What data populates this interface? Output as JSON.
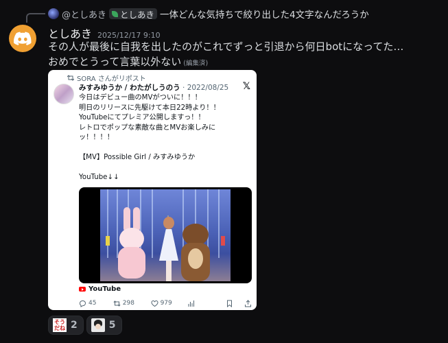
{
  "reply": {
    "username": "@としあき",
    "role_label": "としあき",
    "text": "一体どんな気持ちで絞り出した4文字なんだろうか"
  },
  "message": {
    "author": "としあき",
    "timestamp": "2025/12/17 9:10",
    "line1": "その人が最後に自我を出したのがこれでずっと引退から何日botになってた…",
    "line2": "おめでとうって言葉以外ない",
    "edited": "(編集済)"
  },
  "embed": {
    "repost": "SORA さんがリポスト",
    "author_name": "みすみゆうか / わたがしうのう",
    "date": "2022/08/25",
    "x_logo": "𝕏",
    "body": "今日はデビュー曲のMVがついに！！！\n明日のリリースに先駆けて本日22時より！！\nYouTubeにてプレミア公開しますっ！！\nレトロでポップな素敵な曲とMVお楽しみにッ！！！！\n\n【MV】Possible Girl / みすみゆうか\n\nYouTube↓↓",
    "source_label": "YouTube",
    "replies": "45",
    "reposts": "298",
    "likes": "979"
  },
  "reactions": [
    {
      "emoji": "sou-tane-emoji",
      "emoji_text": "そうだね",
      "count": "2"
    },
    {
      "emoji": "face-emoji",
      "count": "5"
    }
  ],
  "colors": {
    "background": "#0d0d0f",
    "avatar": "#f0a032",
    "embed_bg": "#ffffff"
  }
}
